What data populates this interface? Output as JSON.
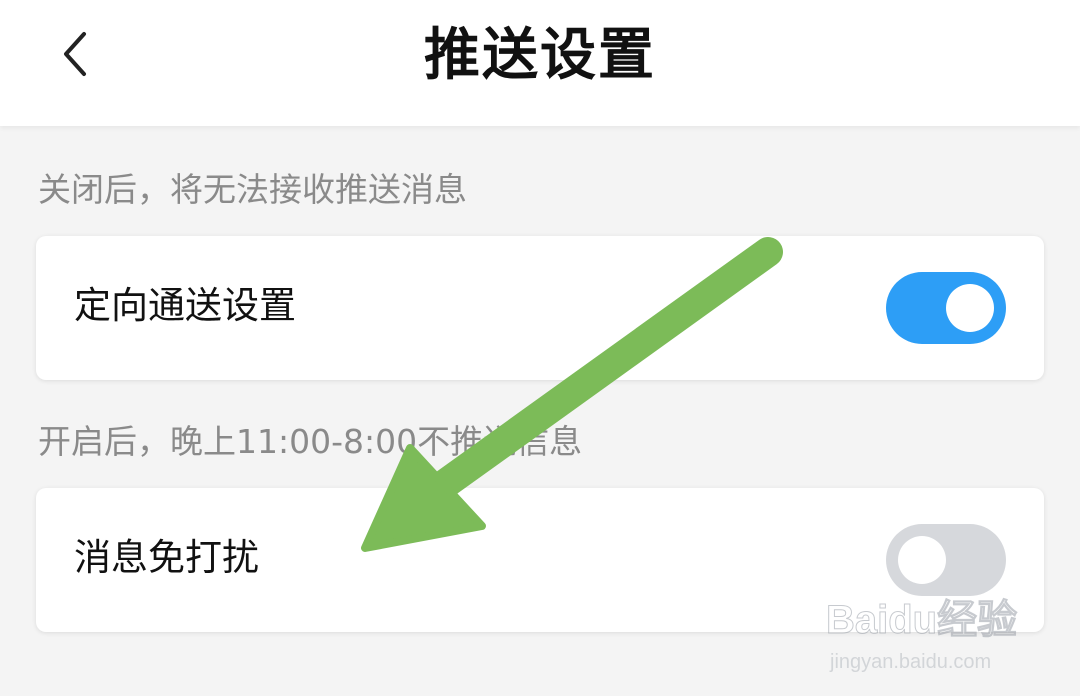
{
  "header": {
    "title": "推送设置",
    "back_icon": "chevron-left-icon"
  },
  "sections": [
    {
      "description": "关闭后，将无法接收推送消息",
      "setting_label": "定向通送设置",
      "toggle_on": true
    },
    {
      "description": "开启后，晚上11:00-8:00不推送信息",
      "setting_label": "消息免打扰",
      "toggle_on": false
    }
  ],
  "watermark": {
    "main": "Baidu经验",
    "sub": "jingyan.baidu.com"
  },
  "colors": {
    "toggle_on": "#2d9ef6",
    "toggle_off": "#d6d8dc",
    "annotation_arrow": "#7cbb58"
  }
}
